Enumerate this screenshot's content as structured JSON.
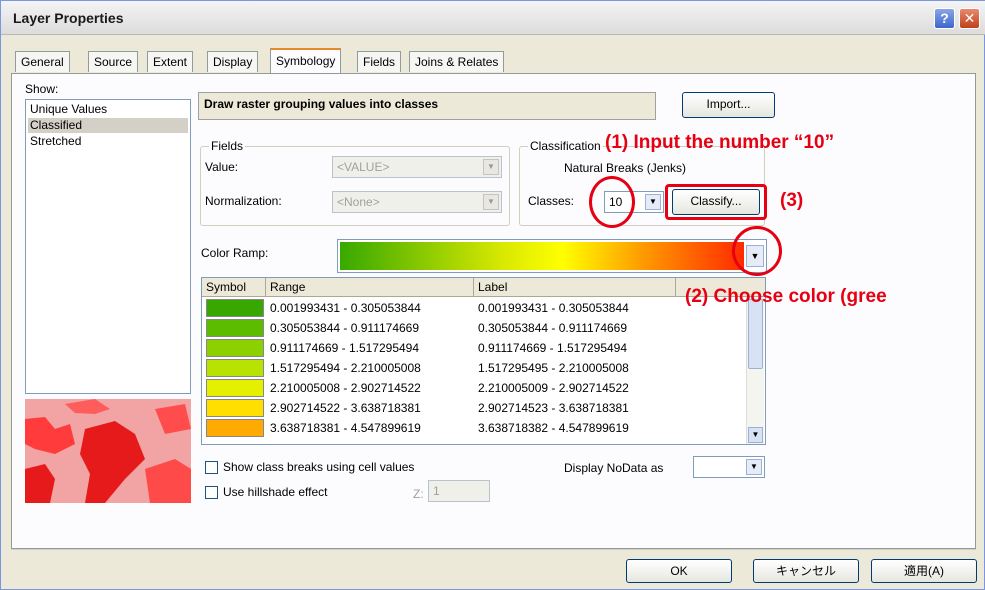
{
  "window": {
    "title": "Layer Properties"
  },
  "tabs": [
    "General",
    "Source",
    "Extent",
    "Display",
    "Symbology",
    "Fields",
    "Joins & Relates"
  ],
  "show": {
    "label": "Show:",
    "items": [
      "Unique Values",
      "Classified",
      "Stretched"
    ],
    "selected": "Classified"
  },
  "description": "Draw raster grouping values into classes",
  "import_label": "Import...",
  "fields": {
    "legend": "Fields",
    "value_label": "Value:",
    "value_selected": "<VALUE>",
    "normalization_label": "Normalization:",
    "normalization_selected": "<None>"
  },
  "classification": {
    "legend": "Classification",
    "method": "Natural Breaks (Jenks)",
    "classes_label": "Classes:",
    "classes_value": "10",
    "classify_label": "Classify..."
  },
  "color_ramp_label": "Color Ramp:",
  "table": {
    "headers": [
      "Symbol",
      "Range",
      "Label"
    ],
    "rows": [
      {
        "color": "#38a800",
        "range": "0.001993431 - 0.305053844",
        "label": "0.001993431 - 0.305053844"
      },
      {
        "color": "#5cbd00",
        "range": "0.305053844 - 0.911174669",
        "label": "0.305053844 - 0.911174669"
      },
      {
        "color": "#8bd100",
        "range": "0.911174669 - 1.517295494",
        "label": "0.911174669 - 1.517295494"
      },
      {
        "color": "#b8e200",
        "range": "1.517295494 - 2.210005008",
        "label": "1.517295495 - 2.210005008"
      },
      {
        "color": "#e4f000",
        "range": "2.210005008 - 2.902714522",
        "label": "2.210005009 - 2.902714522"
      },
      {
        "color": "#ffdf00",
        "range": "2.902714522 - 3.638718381",
        "label": "2.902714523 - 3.638718381"
      },
      {
        "color": "#ffaa00",
        "range": "3.638718381 - 4.547899619",
        "label": "3.638718382 - 4.547899619"
      }
    ]
  },
  "options": {
    "show_breaks_label": "Show class breaks using cell values",
    "hillshade_label": "Use hillshade effect",
    "z_label": "Z:",
    "z_value": "1",
    "nodata_label": "Display NoData as"
  },
  "buttons": {
    "ok": "OK",
    "cancel": "キャンセル",
    "apply": "適用(A)"
  },
  "annotations": {
    "step1": "(1)  Input the number “10”",
    "step2": "(2)  Choose color (gree",
    "step3": "(3)"
  },
  "colors": {
    "annotation": "#e60012",
    "title_bar": "#dcdcdc"
  }
}
